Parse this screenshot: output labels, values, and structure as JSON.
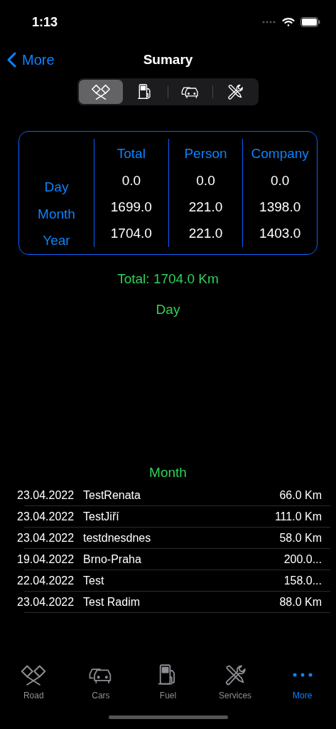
{
  "status_bar": {
    "time": "1:13"
  },
  "nav": {
    "back": "More",
    "title": "Sumary"
  },
  "segments": [
    {
      "kind": "flags",
      "selected": true
    },
    {
      "kind": "fuel",
      "selected": false
    },
    {
      "kind": "cars",
      "selected": false
    },
    {
      "kind": "tools",
      "selected": false
    }
  ],
  "summary_table": {
    "columns": [
      "Total",
      "Person",
      "Company"
    ],
    "rows": [
      {
        "label": "Day",
        "values": [
          "0.0",
          "0.0",
          "0.0"
        ]
      },
      {
        "label": "Month",
        "values": [
          "1699.0",
          "221.0",
          "1398.0"
        ]
      },
      {
        "label": "Year",
        "values": [
          "1704.0",
          "221.0",
          "1403.0"
        ]
      }
    ]
  },
  "total": "Total: 1704.0 Km",
  "day_section": {
    "title": "Day"
  },
  "month_section": {
    "title": "Month",
    "rows": [
      {
        "date": "23.04.2022",
        "name": "TestRenata",
        "distance": "66.0 Km"
      },
      {
        "date": "23.04.2022",
        "name": "TestJiří",
        "distance": "111.0 Km"
      },
      {
        "date": "23.04.2022",
        "name": "testdnesdnes",
        "distance": "58.0 Km"
      },
      {
        "date": "19.04.2022",
        "name": "Brno-Praha",
        "distance": "200.0..."
      },
      {
        "date": "22.04.2022",
        "name": "Test",
        "distance": "158.0..."
      },
      {
        "date": "23.04.2022",
        "name": "Test Radim",
        "distance": "88.0 Km"
      }
    ]
  },
  "tab_bar": [
    {
      "kind": "flags",
      "label": "Road",
      "selected": false
    },
    {
      "kind": "cars",
      "label": "Cars",
      "selected": false
    },
    {
      "kind": "fuel",
      "label": "Fuel",
      "selected": false
    },
    {
      "kind": "tools",
      "label": "Services",
      "selected": false
    },
    {
      "kind": "more",
      "label": "More",
      "selected": true
    }
  ]
}
